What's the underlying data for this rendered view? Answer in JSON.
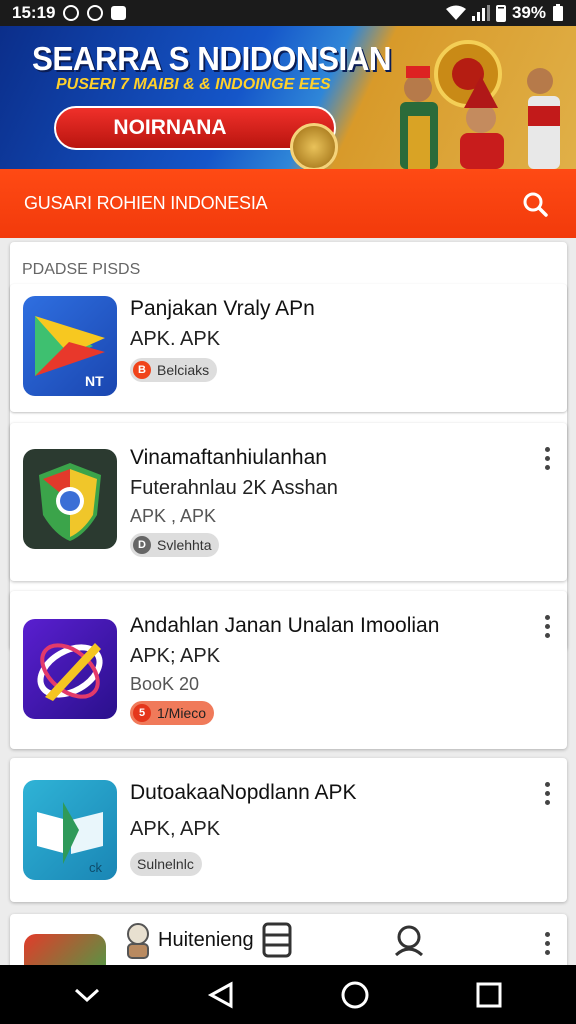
{
  "status_bar": {
    "time": "15:19",
    "battery": "39%"
  },
  "banner": {
    "title": "SEARRA S NDIDONSIAN",
    "subtitle": "PUSERI 7 MAIBI & & INDOINGE EES",
    "button_label": "NOIRNANA"
  },
  "header": {
    "title": "GUSARI ROHIEN INDONESIA"
  },
  "section": {
    "label": "PDADSE PISDS"
  },
  "apps": [
    {
      "name": "Panjakan Vraly APn",
      "line1": "APK. APK",
      "line2": "",
      "badge": "Belciaks",
      "badge_style": "hot-dot",
      "icon": "play-store-icon",
      "icon_text": "NT",
      "has_menu": false
    },
    {
      "name": "Vinamaftanhiulanhan",
      "line1": "Futerahnlau 2K Asshan",
      "line2": "APK , APK",
      "badge": "Svlehhta",
      "badge_style": "grey",
      "icon": "chrome-shield-icon",
      "icon_text": "",
      "has_menu": true
    },
    {
      "name": "Andahlan Janan Unalan Imoolian",
      "line1": "APK; APK",
      "line2": "BooK 20",
      "badge": "1/Mieco",
      "badge_style": "hot",
      "icon": "orbit-pen-icon",
      "icon_text": "",
      "has_menu": true
    },
    {
      "name": "DutoakaaNopdlann APK",
      "line1": "APK, APK",
      "line2": "",
      "badge": "Sulnelnlc",
      "badge_style": "grey",
      "icon": "teal-play-icon",
      "icon_text": "ck",
      "has_menu": true
    }
  ],
  "bottom_tabs": {
    "label": "Huitenieng"
  },
  "colors": {
    "accent": "#f23a0b",
    "banner_blue": "#1556c9",
    "banner_gold": "#e0b048"
  }
}
